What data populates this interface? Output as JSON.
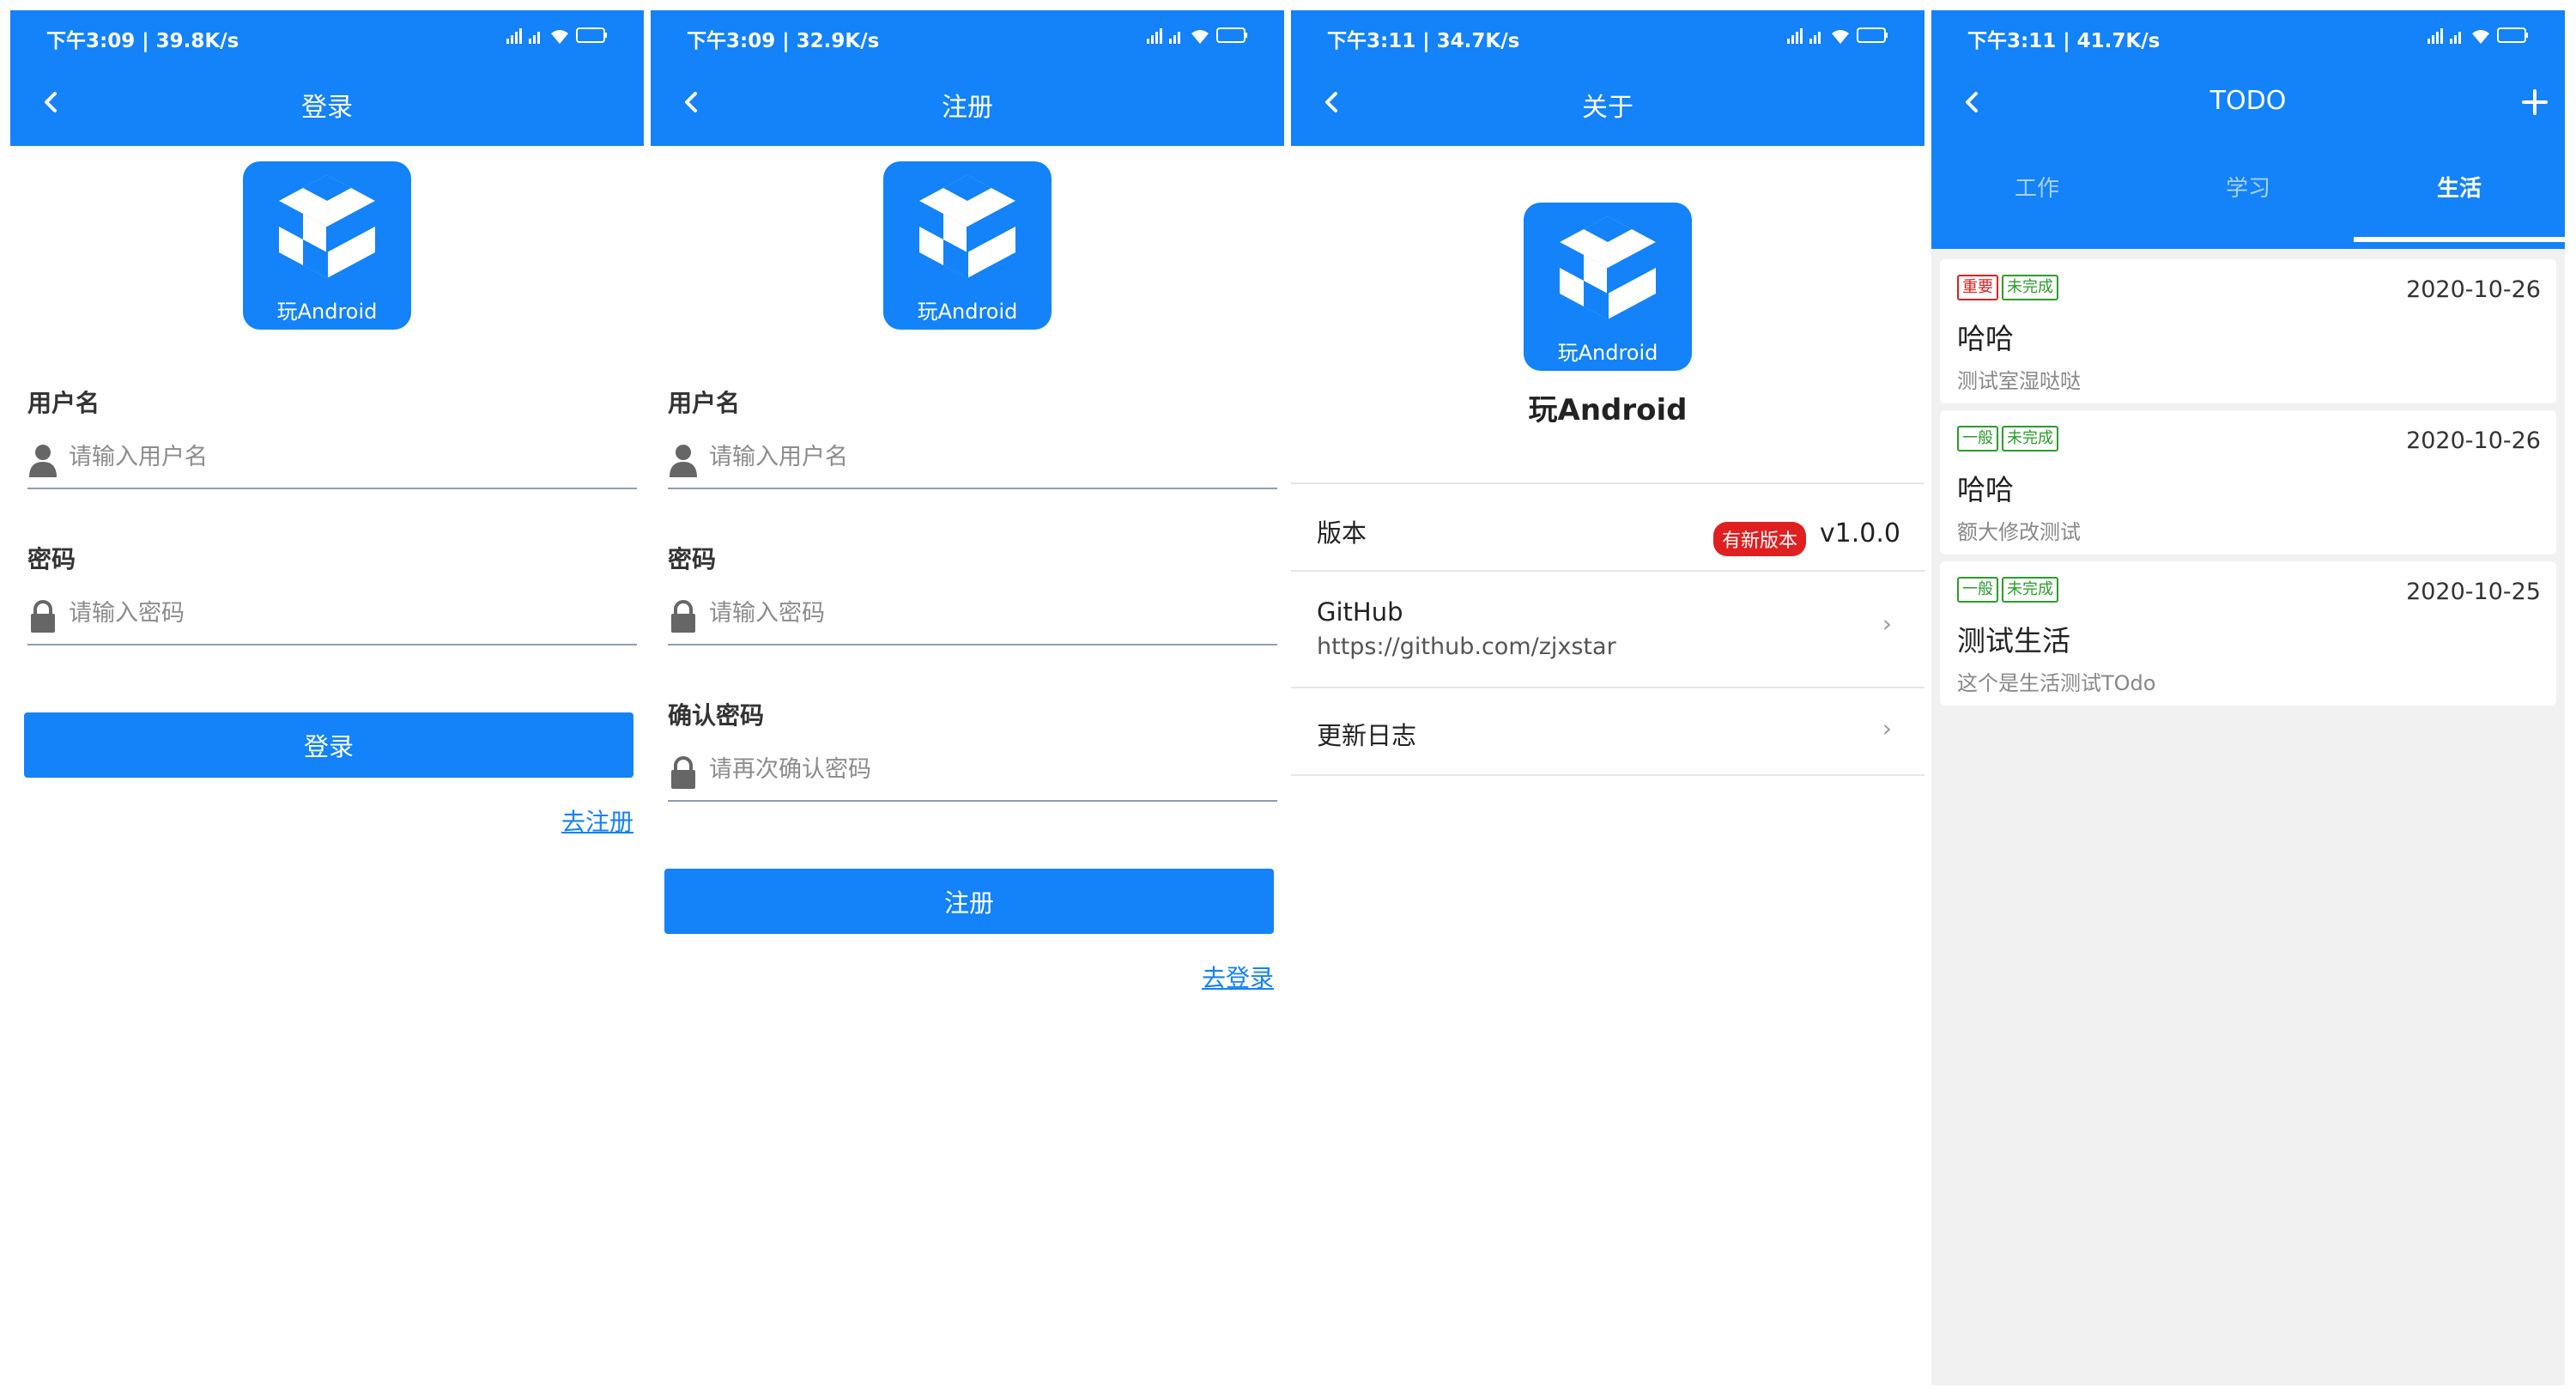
{
  "colors": {
    "primary": "#1482f8",
    "badge_red": "#e02020",
    "tag_green": "#2a9d2a",
    "list_bg": "#f1f1f1"
  },
  "screens": [
    {
      "status": {
        "time": "下午3:09 | 39.8K/s",
        "battery": "100"
      },
      "title": "登录",
      "logo_text": "玩Android",
      "username_label": "用户名",
      "username_placeholder": "请输入用户名",
      "password_label": "密码",
      "password_placeholder": "请输入密码",
      "button": "登录",
      "link": "去注册"
    },
    {
      "status": {
        "time": "下午3:09 | 32.9K/s",
        "battery": "100"
      },
      "title": "注册",
      "logo_text": "玩Android",
      "username_label": "用户名",
      "username_placeholder": "请输入用户名",
      "password_label": "密码",
      "password_placeholder": "请输入密码",
      "confirm_label": "确认密码",
      "confirm_placeholder": "请再次确认密码",
      "button": "注册",
      "link": "去登录"
    },
    {
      "status": {
        "time": "下午3:11 | 34.7K/s",
        "battery": "99"
      },
      "title": "关于",
      "logo_text": "玩Android",
      "app_name": "玩Android",
      "version_label": "版本",
      "new_version_badge": "有新版本",
      "version_value": "v1.0.0",
      "github_label": "GitHub",
      "github_url": "https://github.com/zjxstar",
      "changelog_label": "更新日志"
    },
    {
      "status": {
        "time": "下午3:11 | 41.7K/s",
        "battery": "99"
      },
      "title": "TODO",
      "tabs": [
        {
          "label": "工作"
        },
        {
          "label": "学习"
        },
        {
          "label": "生活"
        }
      ],
      "active_tab": "生活",
      "items": [
        {
          "priority": "重要",
          "status": "未完成",
          "date": "2020-10-26",
          "title": "哈哈",
          "desc": "测试室湿哒哒"
        },
        {
          "priority": "一般",
          "status": "未完成",
          "date": "2020-10-26",
          "title": "哈哈",
          "desc": "额大修改测试"
        },
        {
          "priority": "一般",
          "status": "未完成",
          "date": "2020-10-25",
          "title": "测试生活",
          "desc": "这个是生活测试TOdo"
        }
      ]
    }
  ],
  "icons": {
    "back": "chevron-left-icon",
    "add": "plus-icon",
    "user": "user-icon",
    "lock": "lock-icon",
    "chevron": "chevron-right-icon",
    "logo": "cube-logo-icon"
  }
}
